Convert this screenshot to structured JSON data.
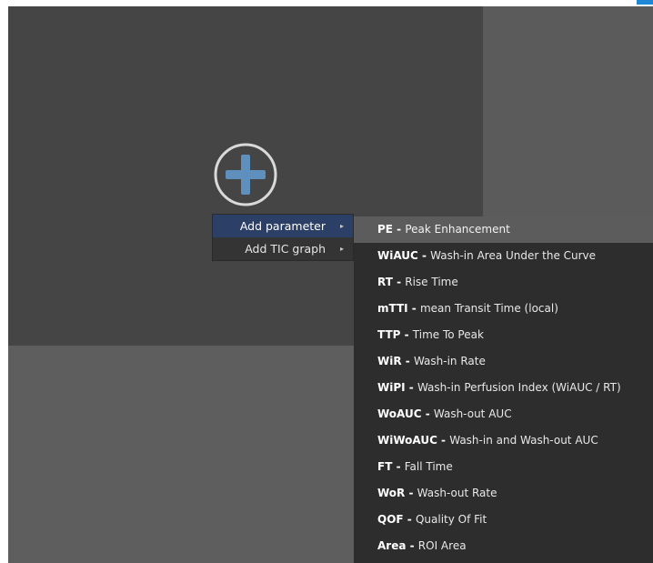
{
  "colors": {
    "panel_main": "#454545",
    "panel_right": "#5b5b5b",
    "panel_bottom": "#5e5e5e",
    "menu_bg": "#343434",
    "menu_active": "#2c3f66",
    "submenu_bg": "#2d2d2d",
    "submenu_hover": "#5c5c5c",
    "plus_icon": "#5f8fbd",
    "accent": "#1e88d6"
  },
  "add_widget": {
    "icon": "plus-circle-icon"
  },
  "context_menu": {
    "items": [
      {
        "label": "Add parameter",
        "arrow": "▸",
        "active": true
      },
      {
        "label": "Add TIC graph",
        "arrow": "▸",
        "active": false
      }
    ]
  },
  "parameters_submenu": {
    "items": [
      {
        "abbr": "PE",
        "sep": " - ",
        "desc": "Peak Enhancement"
      },
      {
        "abbr": "WiAUC",
        "sep": " - ",
        "desc": "Wash-in Area Under the Curve"
      },
      {
        "abbr": "RT",
        "sep": " - ",
        "desc": "Rise Time"
      },
      {
        "abbr": "mTTI",
        "sep": " - ",
        "desc": "mean Transit Time (local)"
      },
      {
        "abbr": "TTP",
        "sep": " - ",
        "desc": "Time To Peak"
      },
      {
        "abbr": "WiR",
        "sep": " - ",
        "desc": "Wash-in Rate"
      },
      {
        "abbr": "WiPI",
        "sep": " - ",
        "desc": "Wash-in Perfusion Index (WiAUC / RT)"
      },
      {
        "abbr": "WoAUC",
        "sep": " - ",
        "desc": "Wash-out AUC"
      },
      {
        "abbr": "WiWoAUC",
        "sep": " - ",
        "desc": "Wash-in and Wash-out AUC"
      },
      {
        "abbr": "FT",
        "sep": " - ",
        "desc": "Fall Time"
      },
      {
        "abbr": "WoR",
        "sep": " - ",
        "desc": "Wash-out Rate"
      },
      {
        "abbr": "QOF",
        "sep": " - ",
        "desc": "Quality Of Fit"
      },
      {
        "abbr": "Area",
        "sep": " - ",
        "desc": "ROI Area"
      }
    ],
    "hovered_index": 0
  }
}
